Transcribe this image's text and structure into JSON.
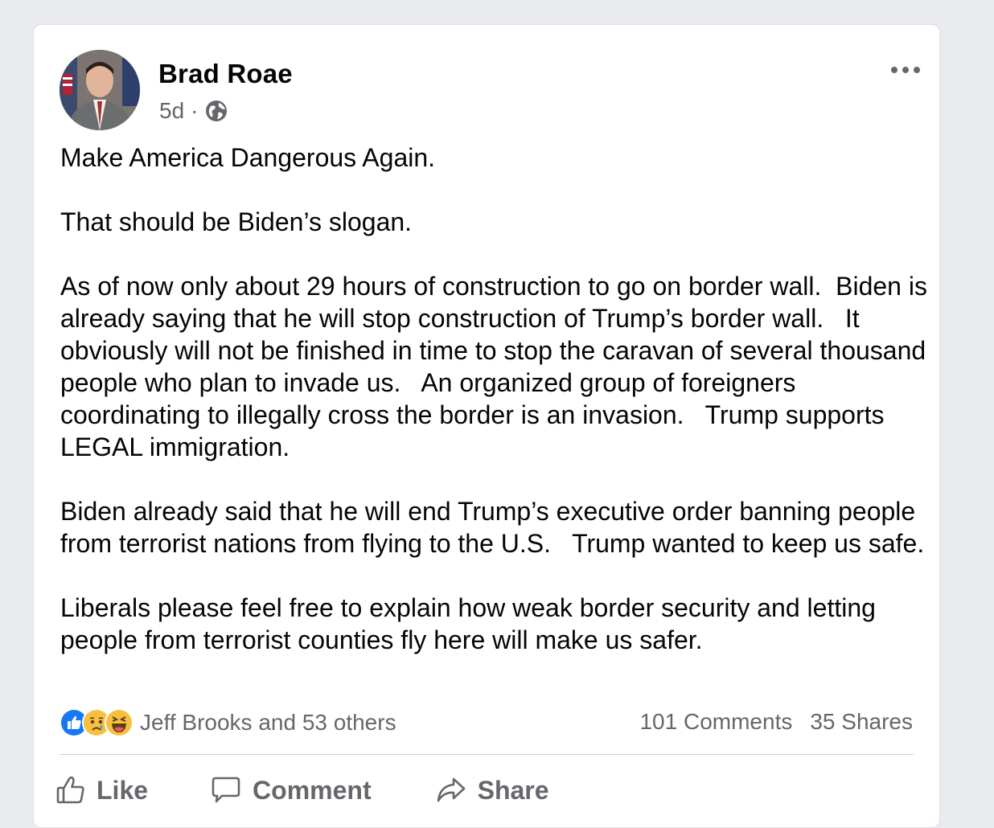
{
  "post": {
    "author": "Brad Roae",
    "age": "5d",
    "separator": "·",
    "privacy_icon": "globe-icon",
    "menu_icon": "more-options-icon",
    "paragraphs": [
      "Make America Dangerous Again.",
      "That should be Biden’s slogan.",
      "As of now only about 29 hours of construction to go on border wall.  Biden is already saying that he will stop construction of Trump’s border wall.   It obviously will not be finished in time to stop the caravan of several thousand people who plan to invade us.   An organized group of foreigners coordinating to illegally cross the border is an invasion.   Trump supports LEGAL immigration.",
      "Biden already said that he will end Trump’s executive order banning people from terrorist nations from flying to the U.S.   Trump wanted to keep us safe.",
      "Liberals please feel free to explain how weak border security and letting people from terrorist counties fly here will make us safer."
    ]
  },
  "reactions": {
    "icons": [
      "like-icon",
      "sad-icon",
      "haha-icon"
    ],
    "names": "Jeff Brooks and 53 others",
    "comments": "101 Comments",
    "shares": "35 Shares"
  },
  "actions": {
    "like": "Like",
    "comment": "Comment",
    "share": "Share"
  },
  "colors": {
    "background": "#e9ebee",
    "card": "#ffffff",
    "secondary_text": "#65676b",
    "like_blue": "#1877f2",
    "emoji_yellow": "#f7c13f"
  }
}
